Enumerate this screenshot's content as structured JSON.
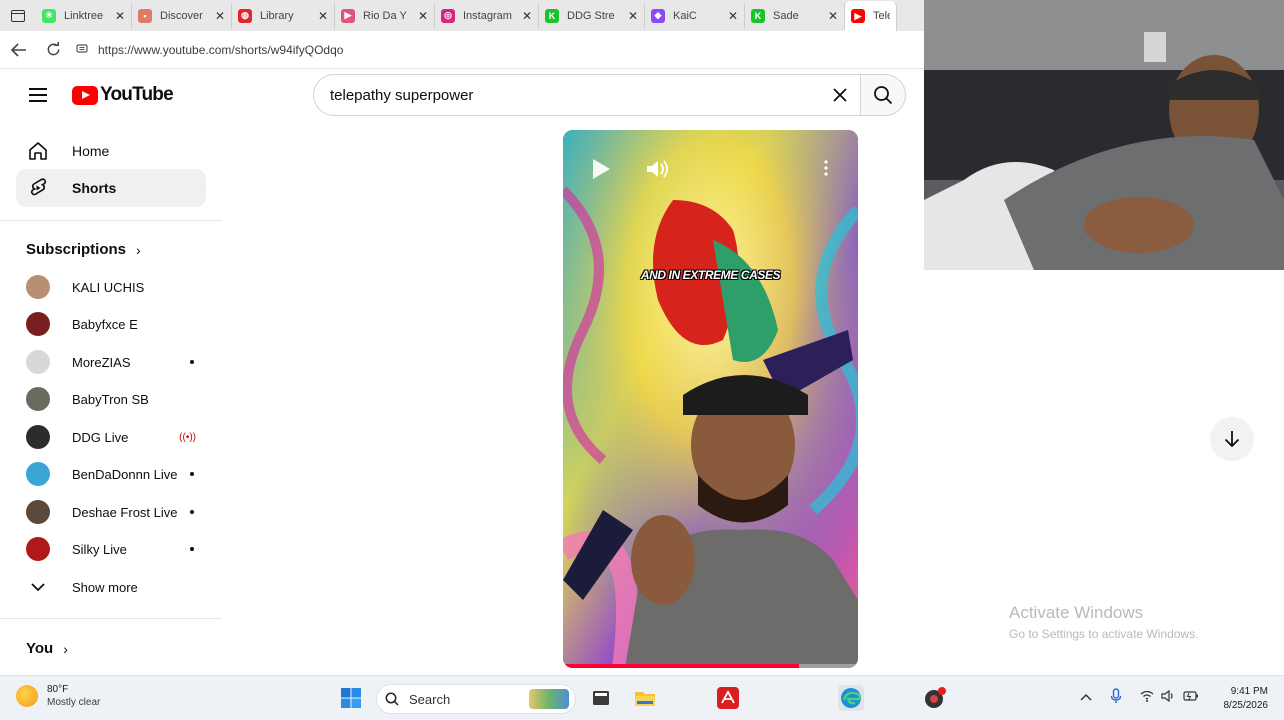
{
  "browser": {
    "tabs": [
      {
        "title": "Linktree",
        "favicon_color": "#43e660",
        "favicon_glyph": "✳"
      },
      {
        "title": "Discover",
        "favicon_color": "#e07a6a",
        "favicon_glyph": "▪"
      },
      {
        "title": "Library",
        "favicon_color": "#e0252f",
        "favicon_glyph": "◍"
      },
      {
        "title": "Rio Da Y",
        "favicon_color": "#e0557a",
        "favicon_glyph": "▶"
      },
      {
        "title": "Instagram",
        "favicon_color": "#d6287a",
        "favicon_glyph": "◎"
      },
      {
        "title": "DDG Stre",
        "favicon_color": "#19c42b",
        "favicon_glyph": "K"
      },
      {
        "title": "KaiC",
        "favicon_color": "#8a4bf4",
        "favicon_glyph": "◆"
      },
      {
        "title": "Sade",
        "favicon_color": "#19c42b",
        "favicon_glyph": "K"
      },
      {
        "title": "Telep",
        "favicon_color": "#ff0000",
        "favicon_glyph": "▶"
      }
    ],
    "url": "https://www.youtube.com/shorts/w94ifyQOdqo"
  },
  "youtube": {
    "logo_text": "YouTube",
    "search_query": "telepathy superpower",
    "nav": {
      "home": "Home",
      "shorts": "Shorts"
    },
    "subscriptions_title": "Subscriptions",
    "subscriptions": [
      {
        "name": "KALI UCHIS",
        "avatar_color": "#b88f73",
        "indicator": "none"
      },
      {
        "name": "Babyfxce E",
        "avatar_color": "#7a1f1f",
        "indicator": "none"
      },
      {
        "name": "MoreZIAS",
        "avatar_color": "#d8d8d8",
        "indicator": "dot"
      },
      {
        "name": "BabyTron SB",
        "avatar_color": "#6a6a5e",
        "indicator": "none"
      },
      {
        "name": "DDG Live",
        "avatar_color": "#2c2c2c",
        "indicator": "live"
      },
      {
        "name": "BenDaDonnn Live",
        "avatar_color": "#3aa6d6",
        "indicator": "dot"
      },
      {
        "name": "Deshae Frost Live",
        "avatar_color": "#5b4a3c",
        "indicator": "dot"
      },
      {
        "name": "Silky Live",
        "avatar_color": "#b01919",
        "indicator": "dot"
      }
    ],
    "show_more": "Show more",
    "you_title": "You",
    "short": {
      "caption": "AND IN EXTREME CASES",
      "progress_fraction": 0.8
    }
  },
  "watermark": {
    "line1": "Activate Windows",
    "line2": "Go to Settings to activate Windows."
  },
  "taskbar": {
    "weather_temp": "80°F",
    "weather_condition": "Mostly clear",
    "search_placeholder": "Search",
    "time": "9:41 PM",
    "date": "8/25/2026"
  }
}
